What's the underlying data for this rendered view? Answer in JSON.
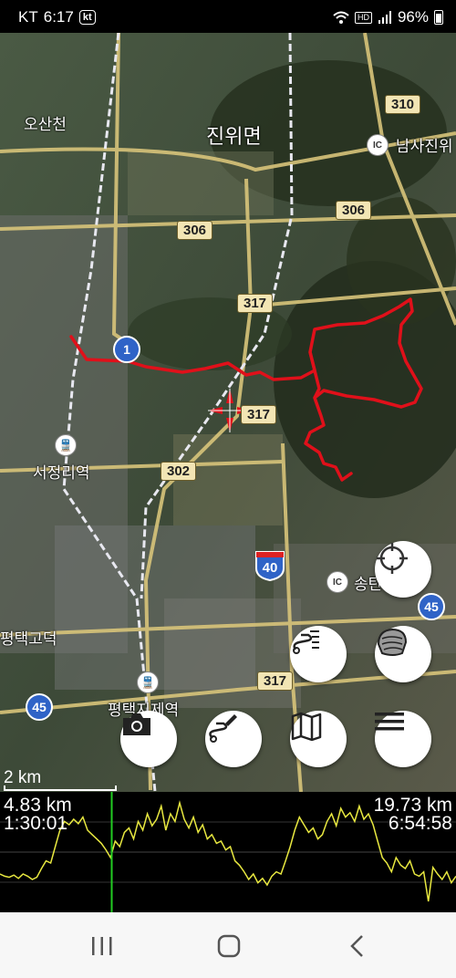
{
  "status_bar": {
    "carrier": "KT",
    "time": "6:17",
    "carrier_badge": "kt",
    "hd_label": "HD",
    "battery": "96%"
  },
  "map": {
    "places": {
      "osancheon": "오산천",
      "jinwimyeon": "진위면",
      "namsajinwi": "남사진위",
      "seojeongri": "서정리역",
      "pyeongtaekgodeok": "평택고덕",
      "pyeongtaekjije": "평택지제역",
      "songtan": "송탄"
    },
    "road_shields": {
      "r310": "310",
      "r306a": "306",
      "r306b": "306",
      "r317a": "317",
      "r317b": "317",
      "r317c": "317",
      "r302": "302",
      "r1": "1",
      "r40": "40",
      "r45a": "45",
      "r45b": "45"
    },
    "ic_label": "IC",
    "scale_label": "2 km",
    "track_color": "#e0101a"
  },
  "elevation": {
    "left_distance": "4.83 km",
    "left_time": "1:30:01",
    "right_distance": "19.73 km",
    "right_time": "6:54:58",
    "cursor_color": "#22cc22",
    "profile_color": "#e8e840",
    "profile": [
      0.3,
      0.28,
      0.27,
      0.29,
      0.26,
      0.3,
      0.28,
      0.25,
      0.27,
      0.35,
      0.42,
      0.4,
      0.55,
      0.7,
      0.78,
      0.75,
      0.8,
      0.76,
      0.82,
      0.7,
      0.66,
      0.62,
      0.58,
      0.52,
      0.45,
      0.6,
      0.55,
      0.68,
      0.72,
      0.62,
      0.78,
      0.7,
      0.85,
      0.74,
      0.8,
      0.92,
      0.7,
      0.85,
      0.78,
      0.95,
      0.8,
      0.72,
      0.82,
      0.68,
      0.75,
      0.62,
      0.66,
      0.58,
      0.6,
      0.52,
      0.55,
      0.42,
      0.38,
      0.32,
      0.25,
      0.3,
      0.22,
      0.26,
      0.2,
      0.28,
      0.32,
      0.3,
      0.42,
      0.55,
      0.7,
      0.82,
      0.75,
      0.68,
      0.72,
      0.62,
      0.66,
      0.78,
      0.85,
      0.74,
      0.9,
      0.82,
      0.86,
      0.78,
      0.92,
      0.8,
      0.85,
      0.75,
      0.6,
      0.45,
      0.4,
      0.32,
      0.45,
      0.38,
      0.35,
      0.42,
      0.3,
      0.28,
      0.32,
      0.05,
      0.36,
      0.3,
      0.25,
      0.32,
      0.22,
      0.28
    ],
    "cursor_fraction": 0.245
  },
  "nav_bar": {
    "recent_icon": "recent-apps-icon",
    "home_icon": "home-icon",
    "back_icon": "back-icon"
  }
}
